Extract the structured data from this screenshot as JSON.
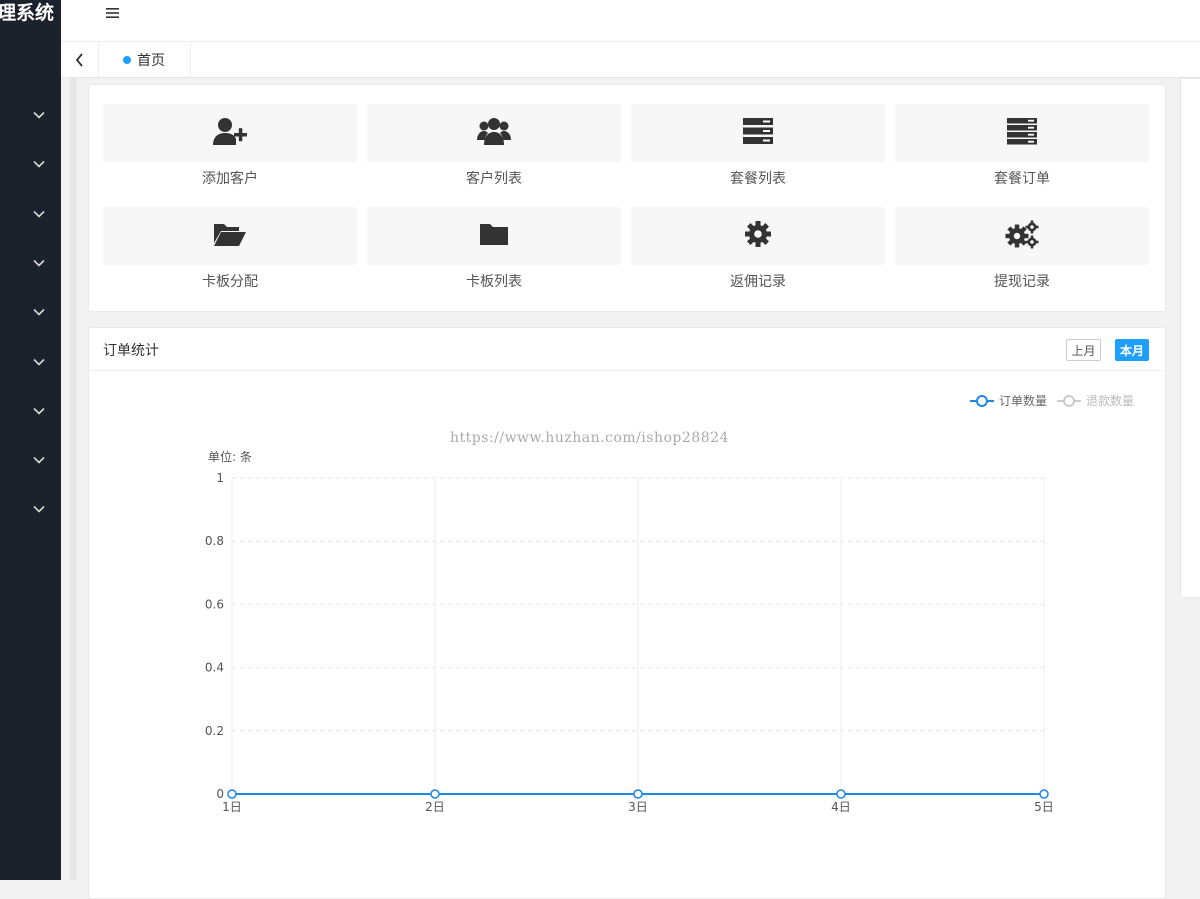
{
  "app": {
    "title_fragment": "理系统"
  },
  "sidebar": {
    "item_count": 9
  },
  "header": {
    "menu_icon": "hamburger-icon"
  },
  "tabs": {
    "home_label": "首页"
  },
  "shortcuts": [
    {
      "label": "添加客户",
      "icon": "user-plus-icon"
    },
    {
      "label": "客户列表",
      "icon": "users-icon"
    },
    {
      "label": "套餐列表",
      "icon": "server-icon"
    },
    {
      "label": "套餐订单",
      "icon": "server-stack-icon"
    },
    {
      "label": "卡板分配",
      "icon": "folder-open-icon"
    },
    {
      "label": "卡板列表",
      "icon": "folder-icon"
    },
    {
      "label": "返佣记录",
      "icon": "gear-icon"
    },
    {
      "label": "提现记录",
      "icon": "gears-icon"
    }
  ],
  "stats": {
    "title": "订单统计",
    "btn_prev": "上月",
    "btn_current": "本月",
    "legend": [
      "订单数量",
      "退款数量"
    ]
  },
  "watermark": "https://www.huzhan.com/ishop28824",
  "chart_data": {
    "type": "line",
    "unit_label": "单位: 条",
    "categories": [
      "1日",
      "2日",
      "3日",
      "4日",
      "5日"
    ],
    "series": [
      {
        "name": "订单数量",
        "values": [
          0,
          0,
          0,
          0,
          0
        ],
        "color": "#1e88e5"
      },
      {
        "name": "退款数量",
        "values": [
          0,
          0,
          0,
          0,
          0
        ],
        "color": "#cccccc"
      }
    ],
    "yticks": [
      "0",
      "0.2",
      "0.4",
      "0.6",
      "0.8",
      "1"
    ],
    "ylim": [
      0,
      1
    ],
    "grid": true,
    "legend_position": "top-right"
  },
  "colors": {
    "accent": "#1e9fff",
    "sidebar": "#1c222b"
  }
}
